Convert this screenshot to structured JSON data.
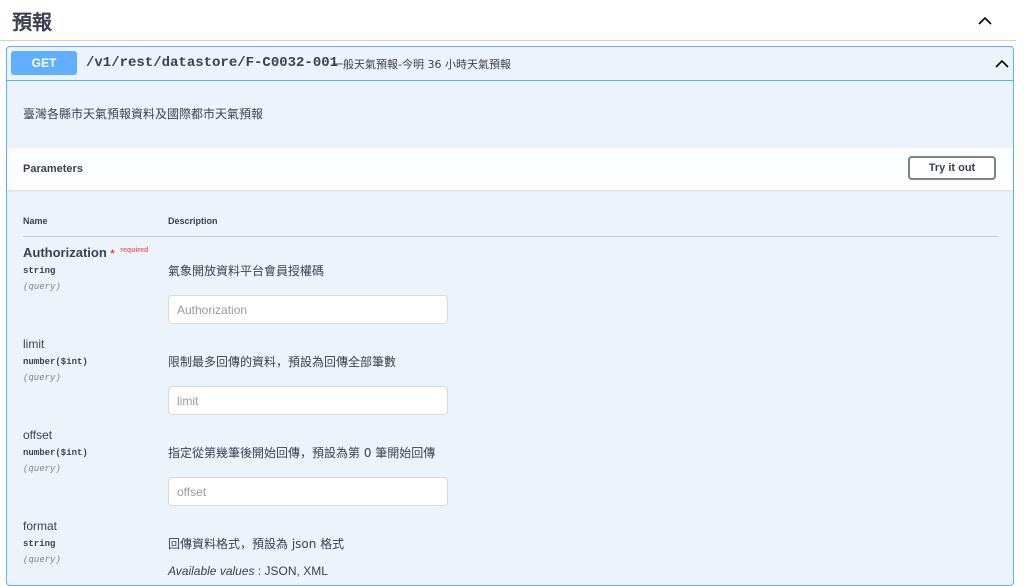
{
  "section": {
    "title": "預報",
    "toggle_icon": "chevron-up-icon"
  },
  "operation": {
    "method": "GET",
    "path": "/v1/rest/datastore/F-C0032-001",
    "summary": "一般天氣預報-今明 36 小時天氣預報",
    "description": "臺灣各縣市天氣預報資料及國際都市天氣預報",
    "colors": {
      "accent": "#61affe",
      "background": "#ebf3fb"
    }
  },
  "parameters": {
    "title": "Parameters",
    "try_label": "Try it out",
    "col_name": "Name",
    "col_description": "Description",
    "items": [
      {
        "name": "Authorization",
        "required_star": "*",
        "required_label": "required",
        "type": "string",
        "in": "(query)",
        "description": "氣象開放資料平台會員授權碼",
        "placeholder": "Authorization"
      },
      {
        "name": "limit",
        "type": "number($int)",
        "in": "(query)",
        "description": "限制最多回傳的資料，預設為回傳全部筆數",
        "placeholder": "limit"
      },
      {
        "name": "offset",
        "type": "number($int)",
        "in": "(query)",
        "description": "指定從第幾筆後開始回傳，預設為第 0 筆開始回傳",
        "placeholder": "offset"
      },
      {
        "name": "format",
        "type": "string",
        "in": "(query)",
        "description": "回傳資料格式，預設為 json 格式",
        "available_label": "Available values",
        "available_values": " : JSON, XML"
      }
    ]
  }
}
